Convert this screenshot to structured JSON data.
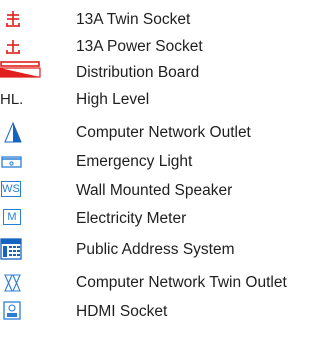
{
  "legend": {
    "items": [
      {
        "symbol": "twin-socket-icon",
        "label": "13A Twin Socket",
        "color": "#e0201c"
      },
      {
        "symbol": "power-socket-icon",
        "label": "13A Power Socket",
        "color": "#e0201c"
      },
      {
        "symbol": "distribution-board-icon",
        "label": "Distribution Board",
        "color": "#e0201c"
      },
      {
        "symbol_text": "HL.",
        "label": "High Level"
      },
      {
        "symbol": "network-outlet-icon",
        "label": "Computer Network Outlet",
        "color": "#1565c0"
      },
      {
        "symbol": "emergency-light-icon",
        "label": "Emergency Light",
        "color": "#2a7fd4"
      },
      {
        "symbol_text": "WS",
        "label": "Wall Mounted Speaker",
        "color": "#2a7fd4"
      },
      {
        "symbol_text": "M",
        "label": "Electricity Meter",
        "color": "#2a7fd4"
      },
      {
        "symbol": "public-address-icon",
        "label": "Public Address System",
        "color": "#1565c0"
      },
      {
        "symbol": "network-twin-outlet-icon",
        "label": "Computer Network Twin Outlet",
        "color": "#2a7fd4"
      },
      {
        "symbol": "hdmi-socket-icon",
        "label": "HDMI Socket",
        "color": "#2a7fd4"
      }
    ]
  }
}
